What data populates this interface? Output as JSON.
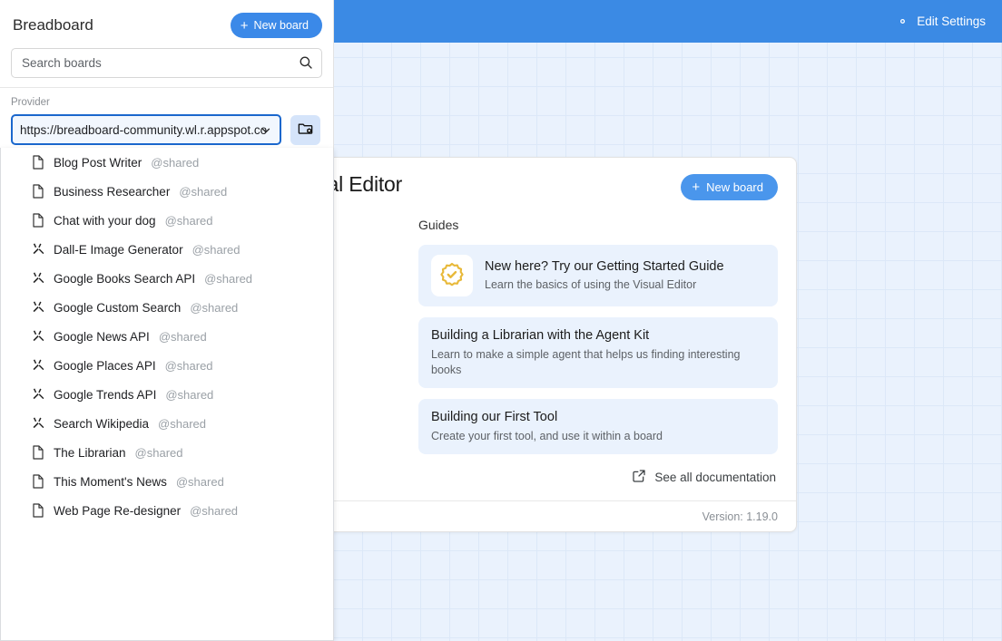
{
  "topbar": {
    "edit_settings_label": "Edit Settings",
    "icon": "gear-icon",
    "background_color": "#3b8ae4"
  },
  "sidebar": {
    "title": "Breadboard",
    "new_board_label": "New board",
    "new_board_plus": "+",
    "search": {
      "placeholder": "Search boards",
      "value": "",
      "icon": "search-icon"
    },
    "provider": {
      "label": "Provider",
      "selected": "https://breadboard-community.wl.r.appspot.co",
      "options": [
        "https://breadboard-community.wl.r.appspot.co"
      ],
      "folder_button_icon": "folder-settings-icon",
      "chevron_icon": "chevron-down-icon"
    },
    "dropdown_items": [
      {
        "icon": "document-icon",
        "name": "Blog Post Writer",
        "owner": "@shared"
      },
      {
        "icon": "document-icon",
        "name": "Business Researcher",
        "owner": "@shared"
      },
      {
        "icon": "document-icon",
        "name": "Chat with your dog",
        "owner": "@shared"
      },
      {
        "icon": "tools-icon",
        "name": "Dall-E Image Generator",
        "owner": "@shared"
      },
      {
        "icon": "tools-icon",
        "name": "Google Books Search API",
        "owner": "@shared"
      },
      {
        "icon": "tools-icon",
        "name": "Google Custom Search",
        "owner": "@shared"
      },
      {
        "icon": "tools-icon",
        "name": "Google News API",
        "owner": "@shared"
      },
      {
        "icon": "tools-icon",
        "name": "Google Places API",
        "owner": "@shared"
      },
      {
        "icon": "tools-icon",
        "name": "Google Trends API",
        "owner": "@shared"
      },
      {
        "icon": "tools-icon",
        "name": "Search Wikipedia",
        "owner": "@shared"
      },
      {
        "icon": "document-icon",
        "name": "The Librarian",
        "owner": "@shared"
      },
      {
        "icon": "document-icon",
        "name": "This Moment's News",
        "owner": "@shared"
      },
      {
        "icon": "document-icon",
        "name": "Web Page Re-designer",
        "owner": "@shared"
      }
    ]
  },
  "welcome": {
    "title": "Visual Editor",
    "new_board_label": "New board",
    "new_board_plus": "+",
    "guides_label": "Guides",
    "guides": [
      {
        "icon": "verified-seal-icon",
        "title": "New here? Try our Getting Started Guide",
        "subtitle": "Learn the basics of using the Visual Editor"
      },
      {
        "title": "Building a Librarian with the Agent Kit",
        "subtitle": "Learn to make a simple agent that helps us finding interesting books"
      },
      {
        "title": "Building our First Tool",
        "subtitle": "Create your first tool, and use it within a board"
      }
    ],
    "documentation_link": "See all documentation",
    "documentation_icon": "external-link-icon",
    "footer_left": "!",
    "footer_right": "Version: 1.19.0"
  }
}
